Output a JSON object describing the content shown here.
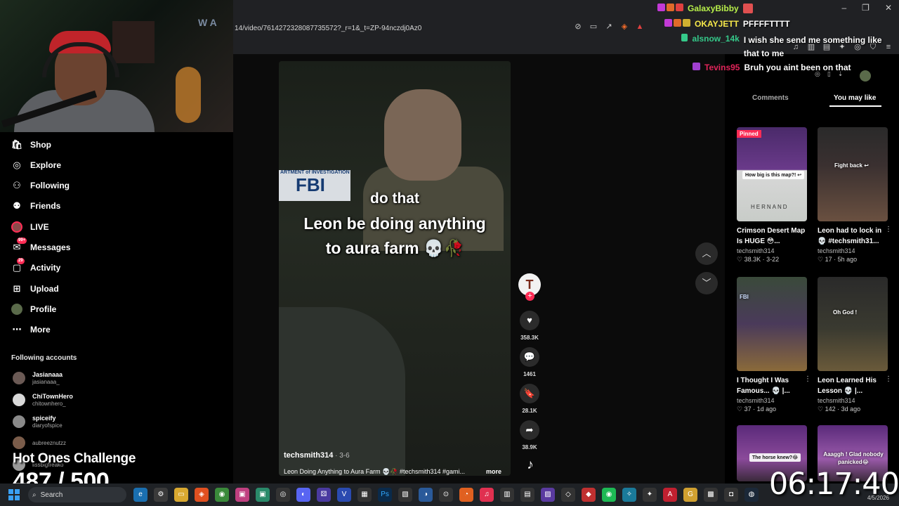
{
  "browser": {
    "url": "14/video/7614272328087735572?_r=1&_t=ZP-94nczdj0Az0",
    "window_controls": [
      "–",
      "❐",
      "✕"
    ]
  },
  "webcam": {
    "logo_text": "W A"
  },
  "sidebar": {
    "nav": [
      {
        "label": "Shop",
        "icon": "shop-icon"
      },
      {
        "label": "Explore",
        "icon": "compass-icon"
      },
      {
        "label": "Following",
        "icon": "following-icon"
      },
      {
        "label": "Friends",
        "icon": "friends-icon"
      },
      {
        "label": "LIVE",
        "icon": "live-avatar-icon"
      },
      {
        "label": "Messages",
        "icon": "messages-icon",
        "badge": "99+"
      },
      {
        "label": "Activity",
        "icon": "activity-icon",
        "badge": "29"
      },
      {
        "label": "Upload",
        "icon": "upload-icon"
      },
      {
        "label": "Profile",
        "icon": "profile-icon"
      },
      {
        "label": "More",
        "icon": "more-icon"
      }
    ],
    "following_heading": "Following accounts",
    "accounts": [
      {
        "name": "Jasianaaa",
        "handle": "jasianaaa_"
      },
      {
        "name": "ChiTownHero",
        "handle": "chitownhero_"
      },
      {
        "name": "spiceify",
        "handle": "diaryofspice"
      },
      {
        "name": "",
        "handle": "aubreeznutzz"
      },
      {
        "name": "",
        "handle": "lissbigfreako"
      }
    ]
  },
  "overlay": {
    "challenge_title": "Hot Ones Challenge",
    "challenge_count": "487 / 500",
    "clock": "06:17:40"
  },
  "video": {
    "sign_top": "ARTMENT of INVESTIGATION",
    "sign_big": "FBI",
    "caption_line1": "do that",
    "caption_line2": "Leon be doing anything",
    "caption_line3": "to aura farm 💀🥀",
    "author": "techsmith314",
    "date": " · 3-6",
    "description": "Leon Doing Anything to Aura Farm 💀🥀 #techsmith314 #gami...",
    "more_label": "more",
    "progress": 0.98,
    "creator_initial": "T"
  },
  "actions": {
    "likes": "358.3K",
    "comments": "1461",
    "saves": "28.1K",
    "shares": "38.9K"
  },
  "chat": [
    {
      "user": "GalaxyBibby",
      "color": "#b8f04a",
      "message": ""
    },
    {
      "user": "OKAYJETT",
      "color": "#f7e94a",
      "message": "PFFFFTTTT"
    },
    {
      "user": "alsnow_14k",
      "color": "#35c98a",
      "message": "I wish she send me something like that to me"
    },
    {
      "user": "Tevins95",
      "color": "#e2245a",
      "message": "Bruh you aint been on that"
    }
  ],
  "panel": {
    "tab_comments": "Comments",
    "tab_you_may_like": "You may like"
  },
  "cards": [
    {
      "title": "Crimson Desert Map Is HUGE 😳...",
      "author": "techsmith314",
      "likes": "38.3K",
      "date": "3-22",
      "pinned": "Pinned",
      "thumb_text": "How big is this map?! ↩",
      "thumb_sub": "HERNAND"
    },
    {
      "title": "Leon had to lock in 💀 #techsmith31...",
      "author": "techsmith314",
      "likes": "17",
      "date": "5h ago",
      "thumb_text": "Fight back ↩"
    },
    {
      "title": "I Thought I Was Famous... 💀 |...",
      "author": "techsmith314",
      "likes": "37",
      "date": "1d ago",
      "thumb_text": "FBI"
    },
    {
      "title": "Leon Learned His Lesson 💀 |...",
      "author": "techsmith314",
      "likes": "142",
      "date": "3d ago",
      "thumb_text": "Oh God !"
    },
    {
      "title": "",
      "author": "",
      "likes": "",
      "date": "",
      "thumb_text": "The horse knew?😂"
    },
    {
      "title": "",
      "author": "",
      "likes": "",
      "date": "",
      "thumb_text": "Aaaggh ! Glad nobody panicked😂"
    }
  ],
  "taskbar": {
    "search_label": "Search",
    "date": "4/5/2026"
  },
  "colors": {
    "accent": "#fe2c55",
    "background": "#000000",
    "panel": "#202124"
  }
}
